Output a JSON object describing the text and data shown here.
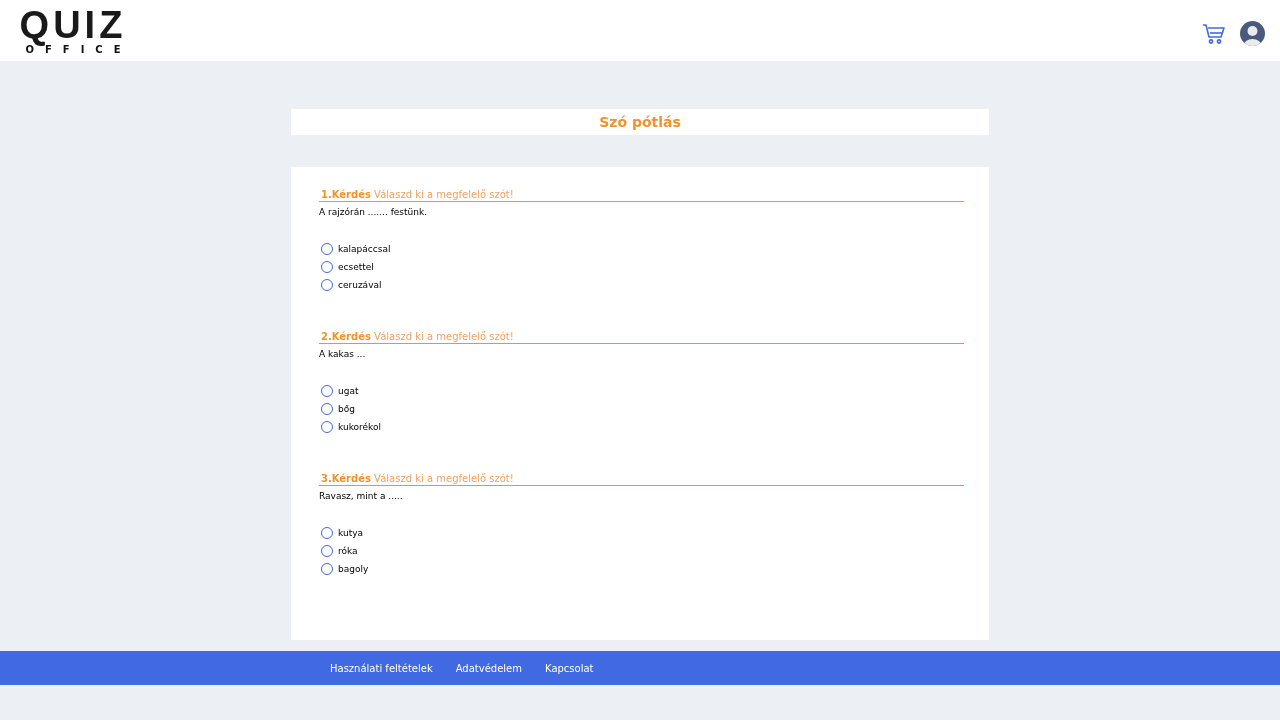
{
  "logo": {
    "word": "QUIZ",
    "subword": "OFFICE"
  },
  "title": "Szó pótlás",
  "questions": [
    {
      "number": "1.Kérdés",
      "instruction": "Válaszd ki a megfelelő szót!",
      "text": "A rajzórán ....... festünk.",
      "options": [
        {
          "label": "kalapáccsal",
          "selected": false
        },
        {
          "label": "ecsettel",
          "selected": false
        },
        {
          "label": "ceruzával",
          "selected": false
        }
      ]
    },
    {
      "number": "2.Kérdés",
      "instruction": "Válaszd ki a megfelelő szót!",
      "text": "A kakas ...",
      "options": [
        {
          "label": "ugat",
          "selected": false
        },
        {
          "label": "bőg",
          "selected": false
        },
        {
          "label": "kukorékol",
          "selected": false
        }
      ]
    },
    {
      "number": "3.Kérdés",
      "instruction": "Válaszd ki a megfelelő szót!",
      "text": "Ravasz, mint a .....",
      "options": [
        {
          "label": "kutya",
          "selected": false
        },
        {
          "label": "róka",
          "selected": false
        },
        {
          "label": "bagoly",
          "selected": false
        }
      ]
    }
  ],
  "footer_links": [
    "Használati feltételek",
    "Adatvédelem",
    "Kapcsolat"
  ]
}
